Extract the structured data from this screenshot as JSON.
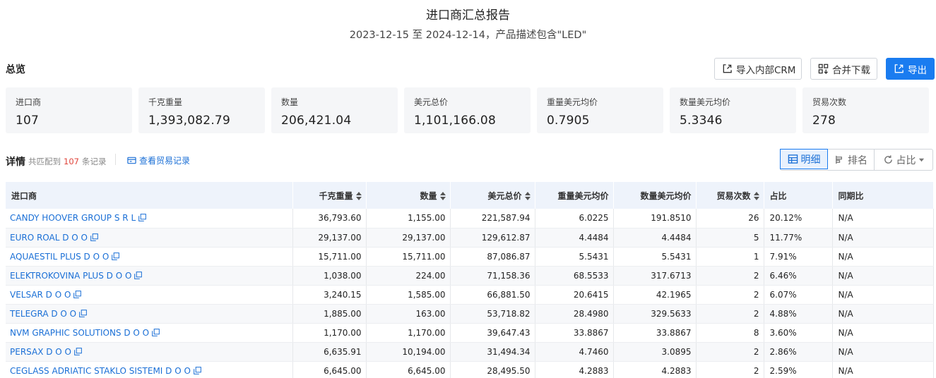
{
  "header": {
    "title": "进口商汇总报告",
    "subtitle": "2023-12-15 至 2024-12-14，产品描述包含\"LED\""
  },
  "overview": {
    "label": "总览",
    "buttons": {
      "import_crm": "导入内部CRM",
      "merge_download": "合并下载",
      "export": "导出"
    },
    "stats": [
      {
        "label": "进口商",
        "value": "107"
      },
      {
        "label": "千克重量",
        "value": "1,393,082.79"
      },
      {
        "label": "数量",
        "value": "206,421.04"
      },
      {
        "label": "美元总价",
        "value": "1,101,166.08"
      },
      {
        "label": "重量美元均价",
        "value": "0.7905"
      },
      {
        "label": "数量美元均价",
        "value": "5.3346"
      },
      {
        "label": "贸易次数",
        "value": "278"
      }
    ]
  },
  "details": {
    "label": "详情",
    "match_prefix": "共匹配到",
    "match_count": "107",
    "match_suffix": "条记录",
    "view_trade_records": "查看贸易记录",
    "view_modes": {
      "detail": "明细",
      "rank": "排名",
      "share": "占比"
    }
  },
  "table": {
    "columns": [
      "进口商",
      "千克重量",
      "数量",
      "美元总价",
      "重量美元均价",
      "数量美元均价",
      "贸易次数",
      "占比",
      "同期比"
    ],
    "rows": [
      [
        "CANDY HOOVER GROUP S R L",
        "36,793.60",
        "1,155.00",
        "221,587.94",
        "6.0225",
        "191.8510",
        "26",
        "20.12%",
        "N/A"
      ],
      [
        "EURO ROAL D O O",
        "29,137.00",
        "29,137.00",
        "129,612.87",
        "4.4484",
        "4.4484",
        "5",
        "11.77%",
        "N/A"
      ],
      [
        "AQUAESTIL PLUS D O O",
        "15,711.00",
        "15,711.00",
        "87,086.87",
        "5.5431",
        "5.5431",
        "1",
        "7.91%",
        "N/A"
      ],
      [
        "ELEKTROKOVINA PLUS D O O",
        "1,038.00",
        "224.00",
        "71,158.36",
        "68.5533",
        "317.6713",
        "2",
        "6.46%",
        "N/A"
      ],
      [
        "VELSAR D O O",
        "3,240.15",
        "1,585.00",
        "66,881.50",
        "20.6415",
        "42.1965",
        "2",
        "6.07%",
        "N/A"
      ],
      [
        "TELEGRA D O O",
        "1,885.00",
        "163.00",
        "53,718.82",
        "28.4980",
        "329.5633",
        "2",
        "4.88%",
        "N/A"
      ],
      [
        "NVM GRAPHIC SOLUTIONS D O O",
        "1,170.00",
        "1,170.00",
        "39,647.43",
        "33.8867",
        "33.8867",
        "8",
        "3.60%",
        "N/A"
      ],
      [
        "PERSAX D O O",
        "6,635.91",
        "10,194.00",
        "31,494.34",
        "4.7460",
        "3.0895",
        "2",
        "2.86%",
        "N/A"
      ],
      [
        "CEGLASS ADRIATIC STAKLO SISTEMI D O O",
        "6,645.00",
        "6,645.00",
        "28,495.50",
        "4.2883",
        "4.2883",
        "2",
        "2.59%",
        "N/A"
      ]
    ]
  },
  "colors": {
    "accent": "#1a7cf0",
    "link": "#1a6fd6",
    "count_red": "#e0443a",
    "card_bg": "#f5f6f8",
    "header_bg": "#eef3fb"
  }
}
